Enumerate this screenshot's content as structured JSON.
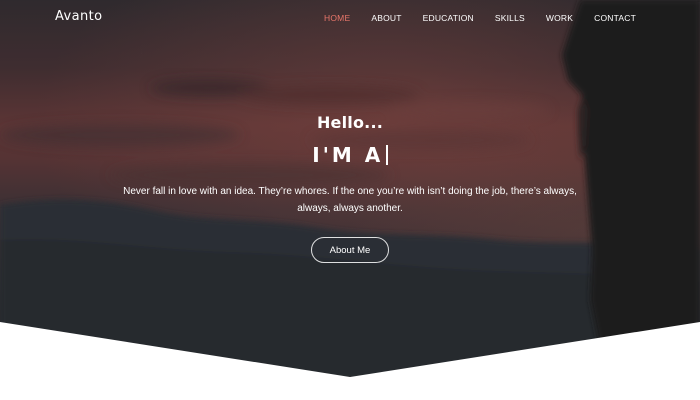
{
  "brand": {
    "name": "Avanto"
  },
  "nav": {
    "items": [
      {
        "label": "HOME",
        "active": true
      },
      {
        "label": "ABOUT",
        "active": false
      },
      {
        "label": "EDUCATION",
        "active": false
      },
      {
        "label": "SKILLS",
        "active": false
      },
      {
        "label": "WORK",
        "active": false
      },
      {
        "label": "CONTACT",
        "active": false
      }
    ],
    "active_color": "#e8766a"
  },
  "hero": {
    "greeting": "Hello...",
    "typed_text": "I'M A",
    "quote": "Never fall in love with an idea. They’re whores. If the one you’re with isn’t doing the job, there’s always, always, always another.",
    "button_label": "About Me"
  },
  "colors": {
    "sky_top": "#3a2e30",
    "sky_mid": "#6a3a38",
    "hills": "#2d3036",
    "text": "#ffffff"
  }
}
